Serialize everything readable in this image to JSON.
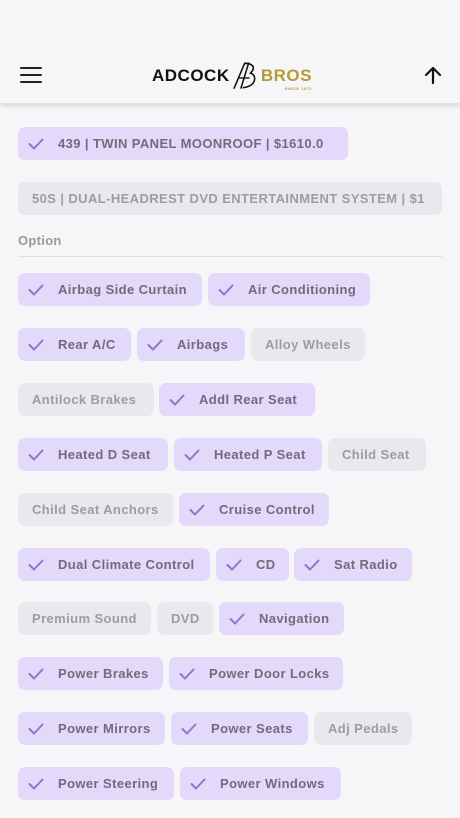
{
  "header": {
    "logo_left": "ADCOCK",
    "logo_right": "BROS",
    "logo_since": "SINCE 1972",
    "menu_icon": "hamburger-menu-icon",
    "up_icon": "arrow-up-icon"
  },
  "packages": [
    {
      "label": "439 | TWIN PANEL MOONROOF | $1610.0",
      "selected": true
    },
    {
      "label": "50S | DUAL-HEADREST DVD ENTERTAINMENT SYSTEM | $1",
      "selected": false
    }
  ],
  "options_heading": "Option",
  "options": [
    {
      "label": "Airbag Side Curtain",
      "selected": true
    },
    {
      "label": "Air Conditioning",
      "selected": true
    },
    {
      "label": "Rear A/C",
      "selected": true
    },
    {
      "label": "Airbags",
      "selected": true
    },
    {
      "label": "Alloy Wheels",
      "selected": false
    },
    {
      "label": "Antilock Brakes",
      "selected": false
    },
    {
      "label": "Addl Rear Seat",
      "selected": true
    },
    {
      "label": "Heated D Seat",
      "selected": true
    },
    {
      "label": "Heated P Seat",
      "selected": true
    },
    {
      "label": "Child Seat",
      "selected": false
    },
    {
      "label": "Child Seat Anchors",
      "selected": false
    },
    {
      "label": "Cruise Control",
      "selected": true
    },
    {
      "label": "Dual Climate Control",
      "selected": true
    },
    {
      "label": "CD",
      "selected": true
    },
    {
      "label": "Sat Radio",
      "selected": true
    },
    {
      "label": "Premium Sound",
      "selected": false
    },
    {
      "label": "DVD",
      "selected": false
    },
    {
      "label": "Navigation",
      "selected": true
    },
    {
      "label": "Power Brakes",
      "selected": true
    },
    {
      "label": "Power Door Locks",
      "selected": true
    },
    {
      "label": "Power Mirrors",
      "selected": true
    },
    {
      "label": "Power Seats",
      "selected": true
    },
    {
      "label": "Adj Pedals",
      "selected": false
    },
    {
      "label": "Power Steering",
      "selected": true
    },
    {
      "label": "Power Windows",
      "selected": true
    }
  ],
  "colors": {
    "selected_bg": "#e2d9fb",
    "unselected_bg": "#e9e8ec",
    "brand_gold": "#b59a36",
    "check_color": "#8a78c9"
  }
}
